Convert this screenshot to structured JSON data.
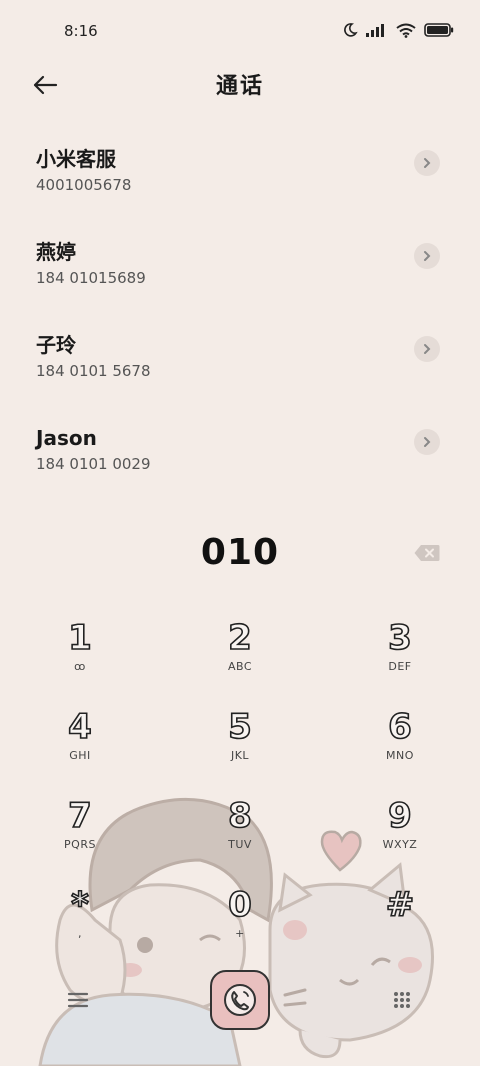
{
  "status": {
    "time": "8:16",
    "icons": [
      "moon-icon",
      "signal-icon",
      "wifi-icon",
      "battery-icon"
    ]
  },
  "header": {
    "title": "通话",
    "back_icon": "arrow-left-icon"
  },
  "contacts": [
    {
      "name": "小米客服",
      "number": "4001005678"
    },
    {
      "name": "燕婷",
      "number": "184 01015689"
    },
    {
      "name": "子玲",
      "number": "184 0101 5678"
    },
    {
      "name": "Jason",
      "number": "184 0101 0029"
    }
  ],
  "dialer": {
    "input": "010",
    "keys": [
      {
        "digit": "1",
        "letters": "ꝏ"
      },
      {
        "digit": "2",
        "letters": "ABC"
      },
      {
        "digit": "3",
        "letters": "DEF"
      },
      {
        "digit": "4",
        "letters": "GHI"
      },
      {
        "digit": "5",
        "letters": "JKL"
      },
      {
        "digit": "6",
        "letters": "MNO"
      },
      {
        "digit": "7",
        "letters": "PQRS"
      },
      {
        "digit": "8",
        "letters": "TUV"
      },
      {
        "digit": "9",
        "letters": "WXYZ"
      },
      {
        "digit": "*",
        "letters": ","
      },
      {
        "digit": "0",
        "letters": "+"
      },
      {
        "digit": "#",
        "letters": ""
      }
    ]
  },
  "colors": {
    "background": "#f4ece7",
    "call_button": "#e9c0bf",
    "arrow_bg": "#e5dcd7"
  }
}
